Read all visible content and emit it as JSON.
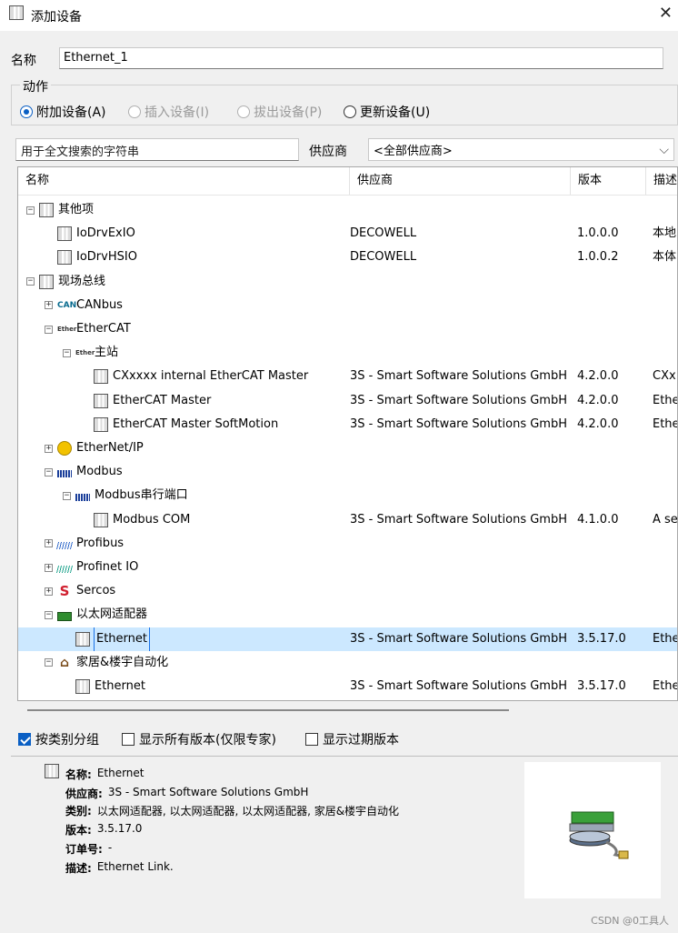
{
  "window": {
    "title": "添加设备",
    "close_glyph": "✕"
  },
  "name_field": {
    "label": "名称",
    "value": "Ethernet_1"
  },
  "actions": {
    "legend": "动作",
    "options": [
      {
        "label": "附加设备(A)",
        "checked": true,
        "enabled": true
      },
      {
        "label": "插入设备(I)",
        "checked": false,
        "enabled": false
      },
      {
        "label": "拔出设备(P)",
        "checked": false,
        "enabled": false
      },
      {
        "label": "更新设备(U)",
        "checked": false,
        "enabled": true
      }
    ]
  },
  "search": {
    "placeholder": "用于全文搜索的字符串"
  },
  "vendor": {
    "label": "供应商",
    "value": "<全部供应商>",
    "arrow": "⌵"
  },
  "columns": {
    "name": "名称",
    "vendor": "供应商",
    "version": "版本",
    "desc": "描述"
  },
  "tree": [
    {
      "label": "其他项",
      "level": 0,
      "expander": "−",
      "icon": "device-icon",
      "vendor": "",
      "version": "",
      "desc": ""
    },
    {
      "label": "IoDrvExIO",
      "level": 1,
      "expander": "",
      "icon": "device-icon",
      "vendor": "DECOWELL",
      "version": "1.0.0.0",
      "desc": "本地"
    },
    {
      "label": "IoDrvHSIO",
      "level": 1,
      "expander": "",
      "icon": "device-icon",
      "vendor": "DECOWELL",
      "version": "1.0.0.2",
      "desc": "本体"
    },
    {
      "label": "现场总线",
      "level": 0,
      "expander": "−",
      "icon": "device-icon",
      "vendor": "",
      "version": "",
      "desc": ""
    },
    {
      "label": "CANbus",
      "level": 1,
      "expander": "+",
      "icon": "can-icon",
      "vendor": "",
      "version": "",
      "desc": ""
    },
    {
      "label": "EtherCAT",
      "level": 1,
      "expander": "−",
      "icon": "ethercat-icon",
      "vendor": "",
      "version": "",
      "desc": ""
    },
    {
      "label": "主站",
      "level": 2,
      "expander": "−",
      "icon": "ethercat-icon",
      "vendor": "",
      "version": "",
      "desc": ""
    },
    {
      "label": "CXxxxx internal EtherCAT Master",
      "level": 3,
      "expander": "",
      "icon": "device-icon",
      "vendor": "3S - Smart Software Solutions GmbH",
      "version": "4.2.0.0",
      "desc": "CXx"
    },
    {
      "label": "EtherCAT Master",
      "level": 3,
      "expander": "",
      "icon": "device-icon",
      "vendor": "3S - Smart Software Solutions GmbH",
      "version": "4.2.0.0",
      "desc": "Ethe"
    },
    {
      "label": "EtherCAT Master SoftMotion",
      "level": 3,
      "expander": "",
      "icon": "device-icon",
      "vendor": "3S - Smart Software Solutions GmbH",
      "version": "4.2.0.0",
      "desc": "Ethe"
    },
    {
      "label": "EtherNet/IP",
      "level": 1,
      "expander": "+",
      "icon": "ethernetip-icon",
      "vendor": "",
      "version": "",
      "desc": ""
    },
    {
      "label": "Modbus",
      "level": 1,
      "expander": "−",
      "icon": "modbus-icon",
      "vendor": "",
      "version": "",
      "desc": ""
    },
    {
      "label": "Modbus串行端口",
      "level": 2,
      "expander": "−",
      "icon": "modbus-icon",
      "vendor": "",
      "version": "",
      "desc": ""
    },
    {
      "label": "Modbus COM",
      "level": 3,
      "expander": "",
      "icon": "device-icon",
      "vendor": "3S - Smart Software Solutions GmbH",
      "version": "4.1.0.0",
      "desc": "A se"
    },
    {
      "label": "Profibus",
      "level": 1,
      "expander": "+",
      "icon": "profibus-icon",
      "vendor": "",
      "version": "",
      "desc": ""
    },
    {
      "label": "Profinet IO",
      "level": 1,
      "expander": "+",
      "icon": "profinet-icon",
      "vendor": "",
      "version": "",
      "desc": ""
    },
    {
      "label": "Sercos",
      "level": 1,
      "expander": "+",
      "icon": "sercos-icon",
      "vendor": "",
      "version": "",
      "desc": ""
    },
    {
      "label": "以太网适配器",
      "level": 1,
      "expander": "−",
      "icon": "adapter-icon",
      "vendor": "",
      "version": "",
      "desc": ""
    },
    {
      "label": "Ethernet",
      "level": 2,
      "expander": "",
      "icon": "device-icon",
      "vendor": "3S - Smart Software Solutions GmbH",
      "version": "3.5.17.0",
      "desc": "Ethe",
      "selected": true
    },
    {
      "label": "家居&楼宇自动化",
      "level": 1,
      "expander": "−",
      "icon": "home-icon",
      "vendor": "",
      "version": "",
      "desc": ""
    },
    {
      "label": "Ethernet",
      "level": 2,
      "expander": "",
      "icon": "device-icon",
      "vendor": "3S - Smart Software Solutions GmbH",
      "version": "3.5.17.0",
      "desc": "Ethe"
    }
  ],
  "options": [
    {
      "label": "按类别分组",
      "checked": true
    },
    {
      "label": "显示所有版本(仅限专家)",
      "checked": false
    },
    {
      "label": "显示过期版本",
      "checked": false
    }
  ],
  "info": {
    "name_key": "名称:",
    "name": "Ethernet",
    "vendor_key": "供应商:",
    "vendor": "3S - Smart Software Solutions GmbH",
    "category_key": "类别:",
    "category": "以太网适配器, 以太网适配器, 以太网适配器, 家居&楼宇自动化",
    "version_key": "版本:",
    "version": "3.5.17.0",
    "order_key": "订单号:",
    "order": "-",
    "desc_key": "描述:",
    "desc": "Ethernet Link."
  },
  "watermark": "CSDN @0工具人",
  "colors": {
    "selection": "#cce8ff",
    "accent": "#0a5fc4",
    "can": "#0a6c8f",
    "sercos": "#d01f2f"
  }
}
